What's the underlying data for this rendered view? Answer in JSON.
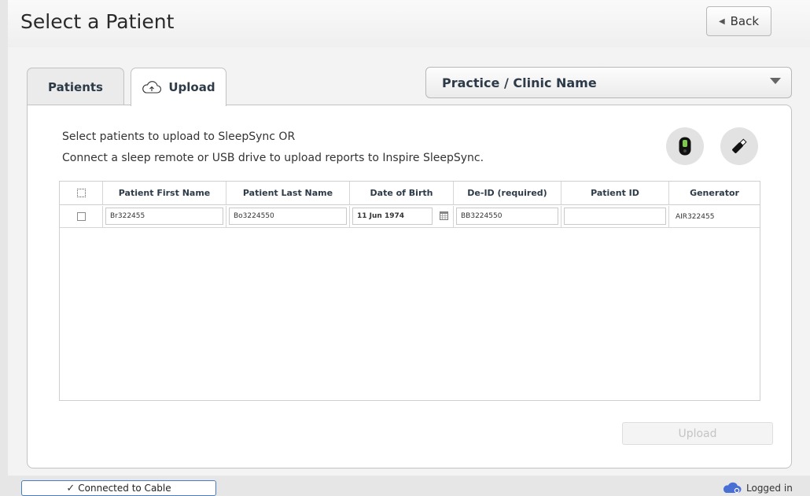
{
  "header": {
    "title": "Select a Patient",
    "back_label": "Back"
  },
  "tabs": [
    {
      "label": "Patients",
      "active": false
    },
    {
      "label": "Upload",
      "active": true,
      "icon": "cloud-upload-icon"
    }
  ],
  "practice_select": {
    "value": "Practice / Clinic Name"
  },
  "instructions": {
    "line1": "Select patients to upload to SleepSync OR",
    "line2": "Connect a sleep remote or USB drive to upload reports to Inspire SleepSync."
  },
  "device_buttons": [
    {
      "icon": "sleep-remote-icon"
    },
    {
      "icon": "usb-drive-icon"
    }
  ],
  "table": {
    "columns": [
      "Patient First Name",
      "Patient Last Name",
      "Date of Birth",
      "De-ID (required)",
      "Patient ID",
      "Generator"
    ],
    "rows": [
      {
        "first_name": "Br322455",
        "last_name": "Bo3224550",
        "dob": "11 Jun 1974",
        "deid": "BB3224550",
        "patient_id": "",
        "generator": "AIR322455"
      }
    ]
  },
  "upload_button": "Upload",
  "status": {
    "connection": "Connected to Cable",
    "login": "Logged in"
  },
  "colors": {
    "accent_text": "#2d3b48",
    "connection_border": "#4a7ebb",
    "login_cloud": "#4a6fd4"
  }
}
